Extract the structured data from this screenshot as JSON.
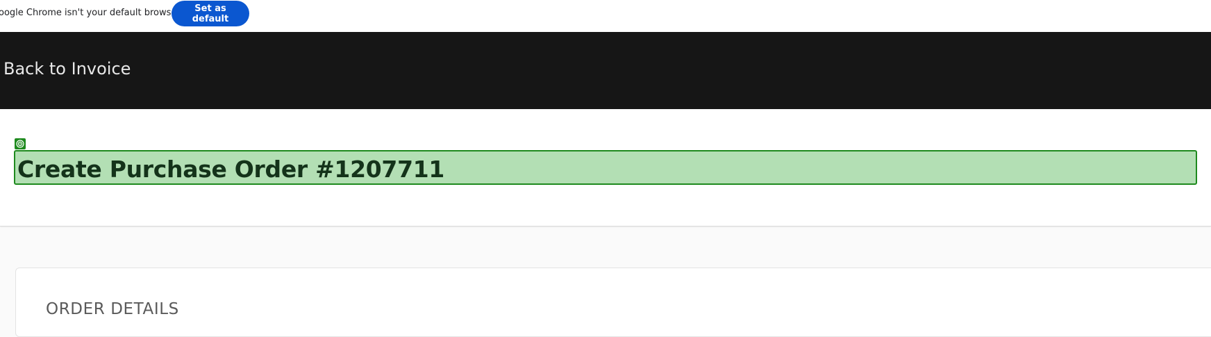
{
  "browser_infobar": {
    "message": "oogle Chrome isn't your default browser",
    "button_label": "Set as default",
    "button_color": "#0b57d0"
  },
  "topbar": {
    "back_link": "Back to Invoice",
    "background": "#161616"
  },
  "header": {
    "title": "Create Purchase Order #1207711",
    "highlight_color": "#b3dfb4",
    "highlight_border": "#1e8a1e",
    "marker_icon": "target-icon"
  },
  "main": {
    "section_heading": "ORDER DETAILS"
  }
}
